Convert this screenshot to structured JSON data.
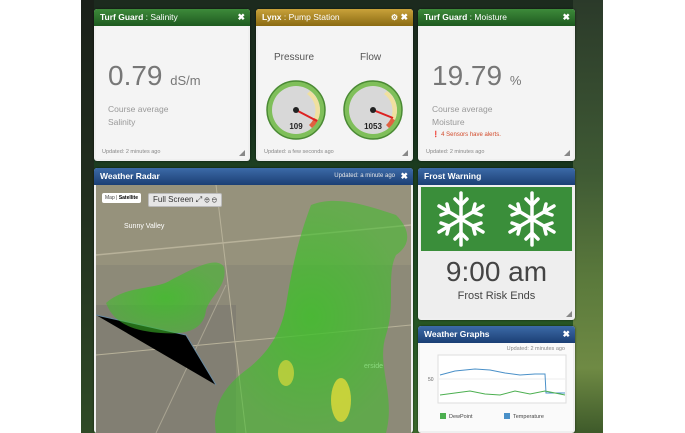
{
  "salinity": {
    "title": "Turf Guard",
    "subtitle": "Salinity",
    "value": "0.79",
    "unit": "dS/m",
    "line1": "Course average",
    "line2": "Salinity",
    "updated": "Updated: 2 minutes ago"
  },
  "pump": {
    "title": "Lynx",
    "subtitle": "Pump Station",
    "pressure_label": "Pressure",
    "pressure_value": "109",
    "flow_label": "Flow",
    "flow_value": "1053",
    "updated": "Updated: a few seconds ago"
  },
  "moisture": {
    "title": "Turf Guard",
    "subtitle": "Moisture",
    "value": "19.79",
    "unit": "%",
    "line1": "Course average",
    "line2": "Moisture",
    "alert": "4 Sensors have alerts.",
    "updated": "Updated: 2 minutes ago"
  },
  "radar": {
    "title": "Weather Radar",
    "updated": "Updated: a minute ago",
    "map_tab": "Map",
    "satellite_tab": "Satellite",
    "fullscreen_label": "Full Screen",
    "map_place_1": "Sunny Valley",
    "map_place_2": "erside"
  },
  "frost": {
    "title": "Frost Warning",
    "time": "9:00 am",
    "label": "Frost Risk Ends"
  },
  "graphs": {
    "title": "Weather Graphs",
    "updated": "Updated: 2 minutes ago",
    "y_tick": "50",
    "legend_dew": "DewPoint",
    "legend_temp": "Temperature",
    "dew_color": "#4caf50",
    "temp_color": "#4a90c8"
  }
}
